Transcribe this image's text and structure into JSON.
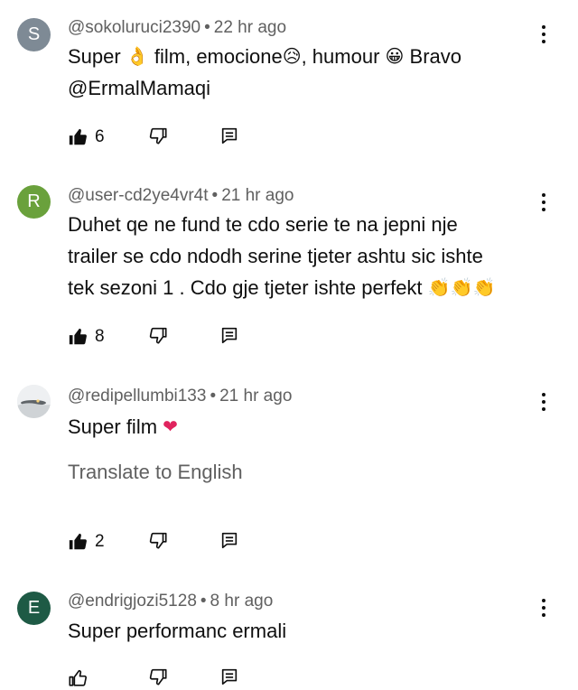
{
  "colors": {
    "avatar_s": "#7e8a95",
    "avatar_r": "#6aa13c",
    "avatar_e": "#1e5a45",
    "meta_text": "#606060",
    "body_text": "#0f0f0f"
  },
  "comments": [
    {
      "avatar_letter": "S",
      "author": "@sokoluruci2390",
      "time": "22 hr ago",
      "text_lines": [
        "Super",
        "film, emocione",
        ", humour",
        "Bravo",
        "@ErmalMamaqi"
      ],
      "emoji": [
        "ok-hand-emoji",
        "sad-relieved-face-emoji",
        "grinning-face-emoji"
      ],
      "likes": "6"
    },
    {
      "avatar_letter": "R",
      "author": "@user-cd2ye4vr4t",
      "time": "21 hr ago",
      "text_lines": [
        "Duhet qe ne fund te cdo serie te na jepni nje",
        "trailer se cdo ndodh serine tjeter ashtu sic ishte",
        "tek sezoni 1 . Cdo gje tjeter ishte perfekt"
      ],
      "emoji": [
        "clapping-hands-emoji",
        "clapping-hands-emoji",
        "clapping-hands-emoji"
      ],
      "likes": "8"
    },
    {
      "avatar_letter": "",
      "author": "@redipellumbi133",
      "time": "21 hr ago",
      "text_lines": [
        "Super film"
      ],
      "emoji": [
        "red-heart-emoji"
      ],
      "translate": "Translate to English",
      "likes": "2"
    },
    {
      "avatar_letter": "E",
      "author": "@endrigjozi5128",
      "time": "8 hr ago",
      "text_lines": [
        "Super performanc ermali"
      ],
      "emoji": [],
      "likes": ""
    }
  ]
}
